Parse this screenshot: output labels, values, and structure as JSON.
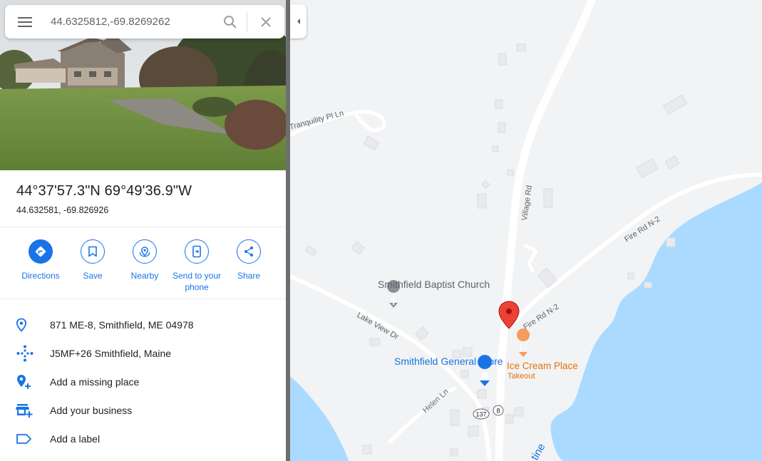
{
  "search": {
    "value": "44.6325812,-69.8269262",
    "menu_icon": "hamburger-menu-icon",
    "search_icon": "magnifier-icon",
    "clear_icon": "close-icon"
  },
  "place": {
    "coord_dms": "44°37'57.3\"N 69°49'36.9\"W",
    "coord_decimal": "44.632581, -69.826926"
  },
  "actions": [
    {
      "label": "Directions",
      "icon": "directions-icon"
    },
    {
      "label": "Save",
      "icon": "bookmark-icon"
    },
    {
      "label": "Nearby",
      "icon": "nearby-icon"
    },
    {
      "label": "Send to your phone",
      "icon": "send-to-phone-icon"
    },
    {
      "label": "Share",
      "icon": "share-icon"
    }
  ],
  "info": [
    {
      "text": "871 ME-8, Smithfield, ME 04978",
      "icon": "location-pin-icon"
    },
    {
      "text": "J5MF+26 Smithfield, Maine",
      "icon": "plus-code-icon"
    },
    {
      "text": "Add a missing place",
      "icon": "add-place-icon"
    },
    {
      "text": "Add your business",
      "icon": "add-business-icon"
    },
    {
      "text": "Add a label",
      "icon": "label-icon"
    }
  ],
  "map": {
    "roads": {
      "village": "Village Rd",
      "tranquility": "Tranquility Pl Ln",
      "fire_upper": "Fire Rd N-2",
      "fire_lower": "Fire Rd N-2",
      "lake_view": "Lake View Dr",
      "helen": "Helen Ln",
      "water_partial": "tine"
    },
    "shields": {
      "route137": "137",
      "route8": "8"
    },
    "places": {
      "church": "Smithfield Baptist Church",
      "store": "Smithfield General Store",
      "ice_cream": "Ice Cream Place",
      "ice_cream_sub": "Takeout"
    },
    "colors": {
      "water": "#aadaff",
      "land": "#f1f3f4",
      "road": "#ffffff",
      "pin": "#ea4335",
      "poi_gray": "#5f6368",
      "poi_blue": "#1a73e8",
      "poi_orange": "#e8710a"
    }
  }
}
